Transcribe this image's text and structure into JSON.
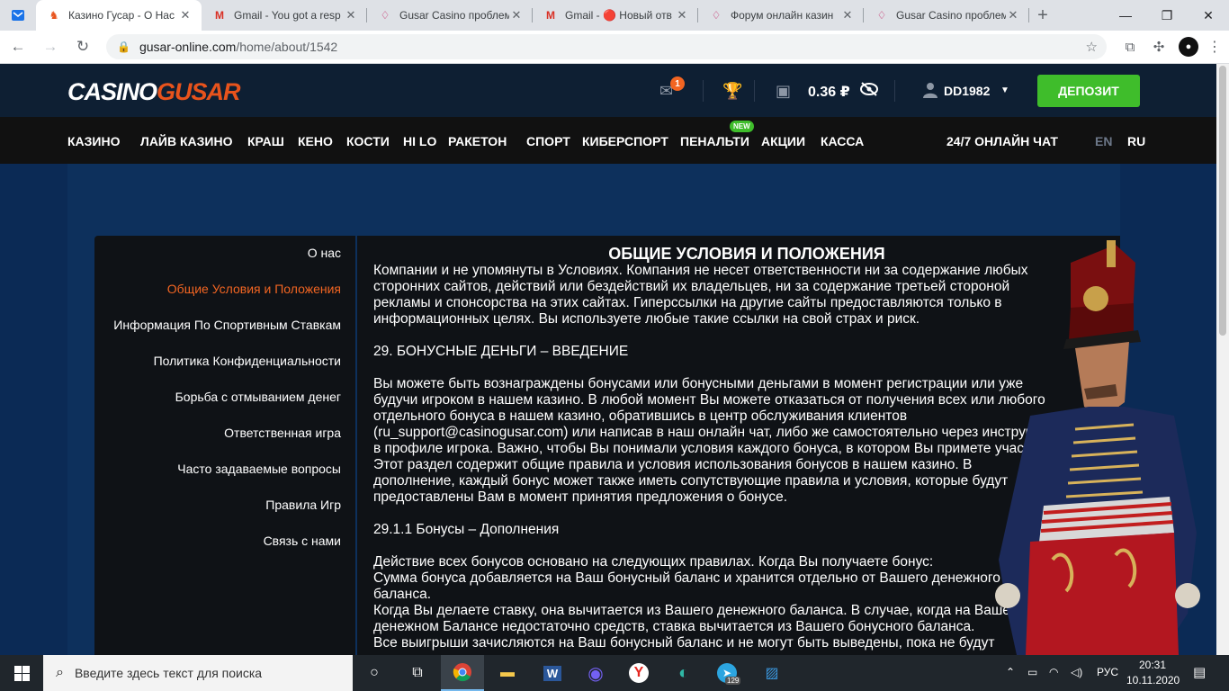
{
  "browser": {
    "tabs": [
      {
        "title": "Казино Гусар - О Нас",
        "icon": "gusar-favicon",
        "active": true
      },
      {
        "title": "Gmail - You got a resp",
        "icon": "gmail-icon"
      },
      {
        "title": "Gusar Casino проблем",
        "icon": "casino-forum-icon"
      },
      {
        "title": "Gmail - 🔴 Новый отв",
        "icon": "gmail-icon"
      },
      {
        "title": "Форум онлайн казин",
        "icon": "casino-forum-icon"
      },
      {
        "title": "Gusar Casino проблем",
        "icon": "casino-forum-icon"
      }
    ],
    "url_host": "gusar-online.com",
    "url_path": "/home/about/1542"
  },
  "site": {
    "logo_part1": "CASINO",
    "logo_part2": "GUSAR",
    "mail_count": "1",
    "balance": "0.36 ₽",
    "username": "DD1982",
    "deposit_label": "ДЕПОЗИТ",
    "nav": [
      "КАЗИНО",
      "ЛАЙВ КАЗИНО",
      "КРАШ",
      "КЕНО",
      "КОСТИ",
      "HI LO",
      "РАКЕТОН",
      "СПОРТ",
      "КИБЕРСПОРТ",
      "ПЕНАЛЬТИ",
      "АКЦИИ",
      "КАССА"
    ],
    "new_badge": "NEW",
    "chat": "24/7 ОНЛАЙН ЧАТ",
    "lang_en": "EN",
    "lang_ru": "RU"
  },
  "sidebar": {
    "items": [
      "О нас",
      "Общие Условия и Положения",
      "Информация По Спортивным Ставкам",
      "Политика Конфиденциальности",
      "Борьба с отмыванием денег",
      "Ответственная игра",
      "Часто задаваемые вопросы",
      "Правила Игр",
      "Связь с нами"
    ],
    "active_index": 1
  },
  "content": {
    "title": "ОБЩИЕ УСЛОВИЯ И ПОЛОЖЕНИЯ",
    "lines": [
      "Компании и не упомянуты в Условиях. Компания не несет ответственности ни за содержание любых",
      "сторонних сайтов, действий или бездействий их владельцев, ни за содержание третьей стороной",
      "рекламы и спонсорства на этих сайтах. Гиперссылки на другие сайты предоставляются только в",
      "информационных целях. Вы используете любые такие ссылки на свой страх и риск.",
      "",
      "29. БОНУСНЫЕ ДЕНЬГИ – ВВЕДЕНИЕ",
      "",
      "Вы можете быть вознаграждены бонусами или бонусными деньгами в момент регистрации или уже",
      "будучи игроком в нашем казино. В любой момент Вы можете отказаться от получения всех или любого",
      "отдельного бонуса в нашем казино, обратившись в центр обслуживания клиентов",
      "(ru_support@casinogusar.com) или написав в наш онлайн чат, либо же самостоятельно через инструмент",
      "в профиле игрока. Важно, чтобы Вы понимали условия каждого бонуса, в котором Вы примете участие.",
      "Этот раздел содержит общие правила и условия использования бонусов в нашем казино. В",
      "дополнение, каждый бонус может также иметь сопутствующие правила и условия, которые будут",
      "предоставлены Вам в момент принятия предложения о бонусе.",
      "",
      "29.1.1 Бонусы – Дополнения",
      "",
      "Действие всех бонусов основано на следующих правилах. Когда Вы получаете бонус:",
      "Сумма бонуса добавляется на Ваш бонусный баланс и хранится отдельно от Вашего денежного",
      "баланса.",
      "Когда Вы делаете ставку, она вычитается из Вашего денежного баланса. В случае, когда на Вашем",
      "денежном Балансе недостаточно средств, ставка вычитается из Вашего бонусного баланса.",
      "Все выигрыши зачисляются на Ваш бонусный баланс и не могут быть выведены, пока не будут"
    ]
  },
  "taskbar": {
    "search_placeholder": "Введите здесь текст для поиска",
    "telegram_badge": "129",
    "lang": "РУС",
    "time": "20:31",
    "date": "10.11.2020"
  }
}
